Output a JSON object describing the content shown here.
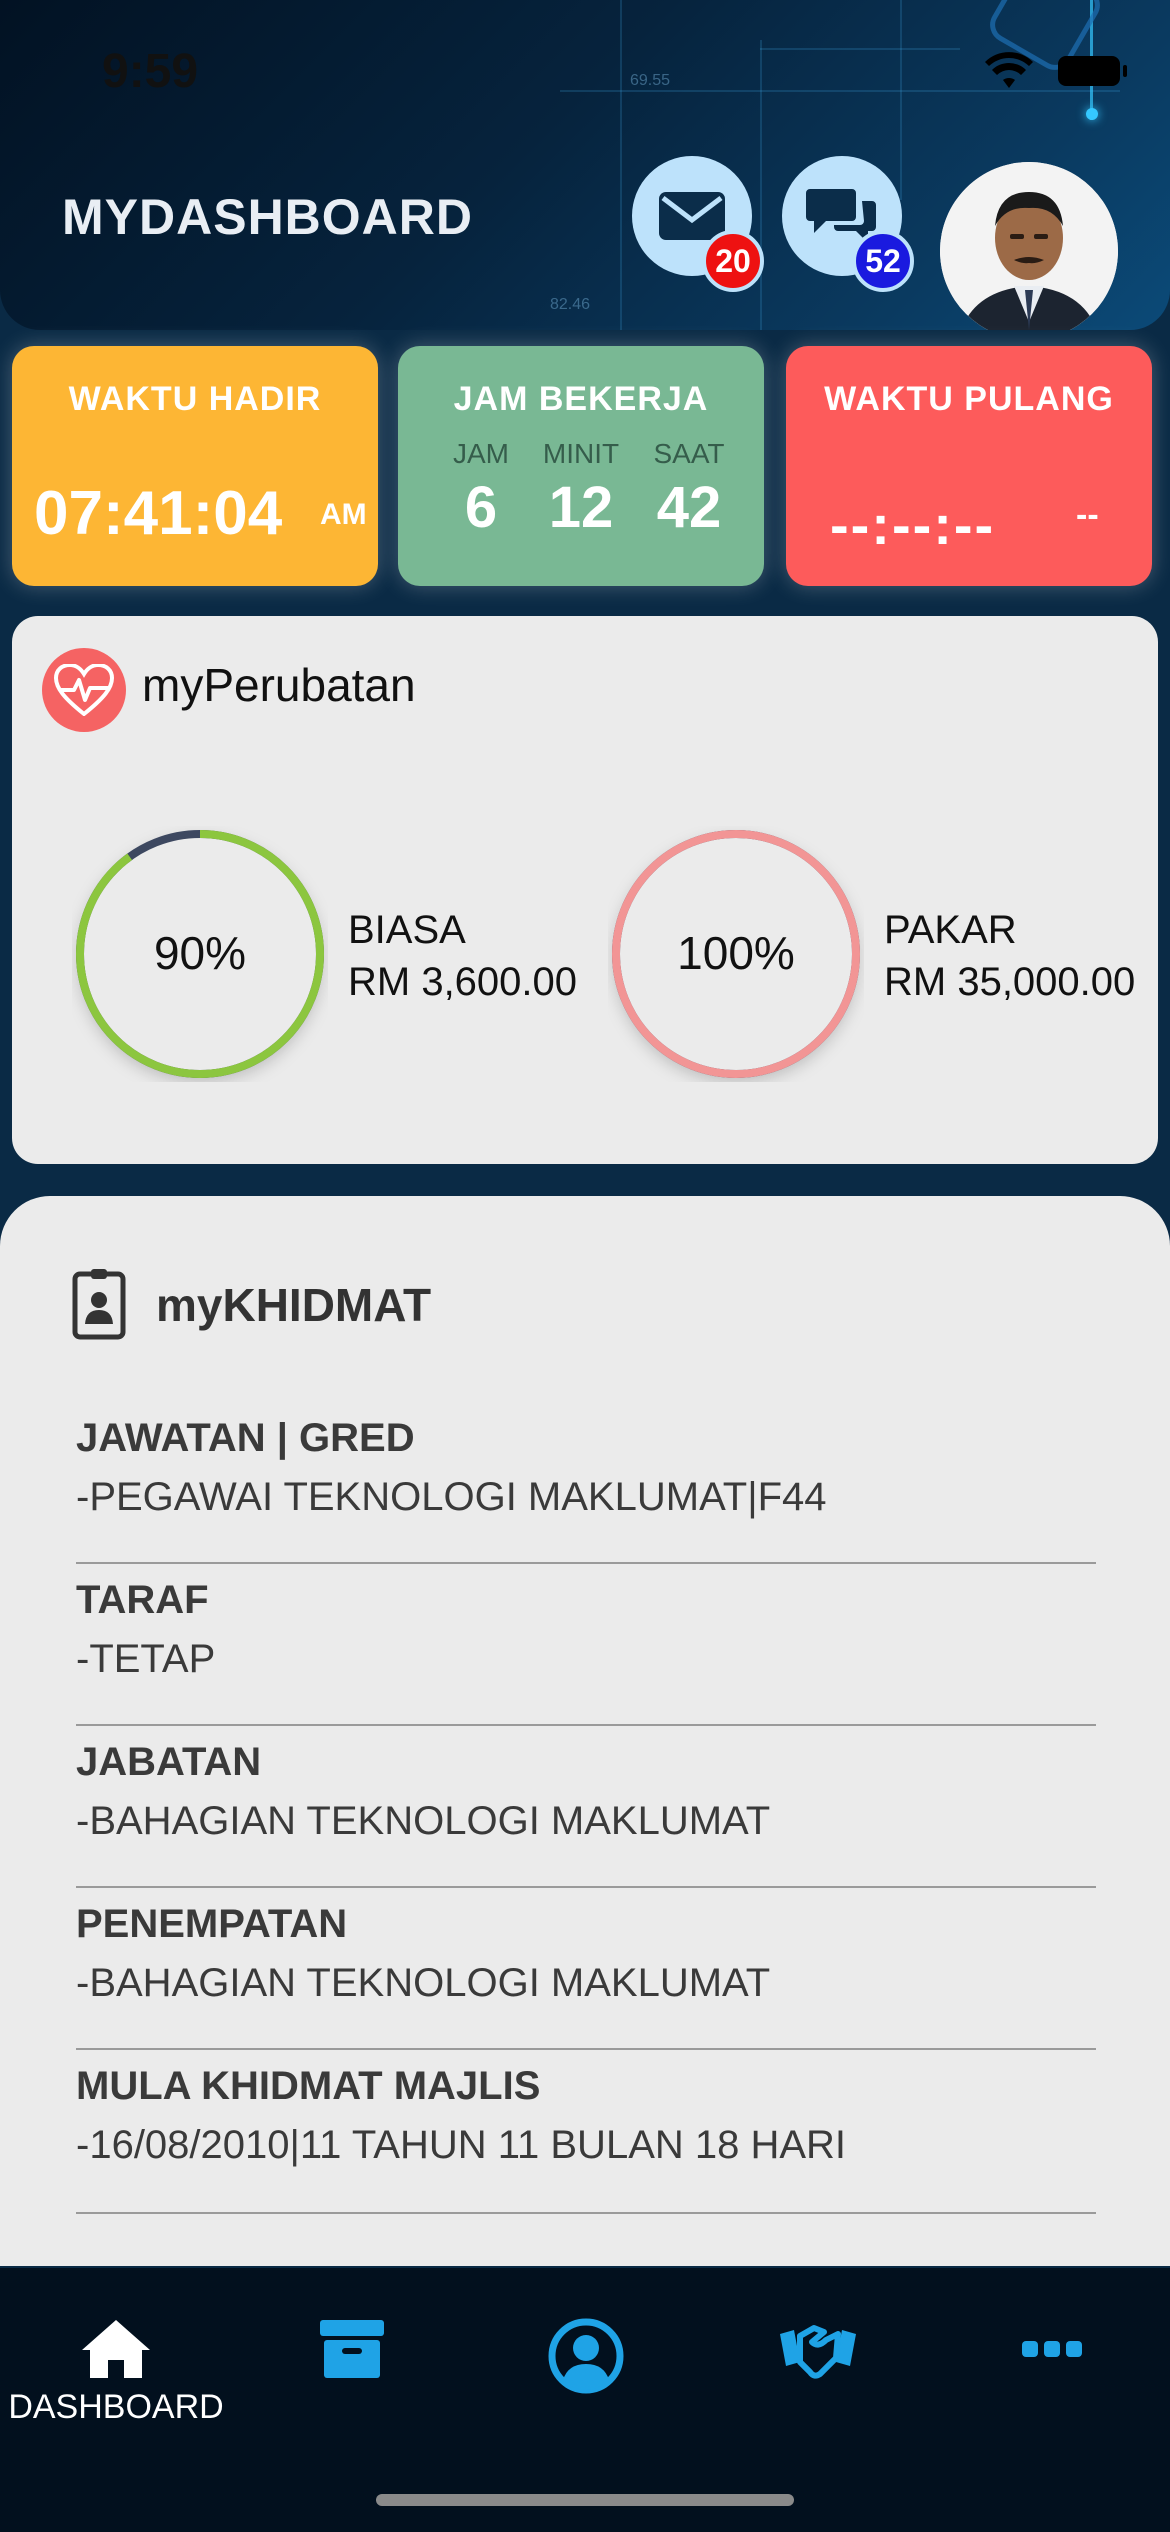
{
  "status_bar": {
    "time": "9:59"
  },
  "header": {
    "title": "MYDASHBOARD",
    "mail_count": "20",
    "chat_count": "52",
    "bg_numbers": [
      "69.55",
      "82.46"
    ]
  },
  "attendance": {
    "hadir": {
      "title": "WAKTU HADIR",
      "time": "07:41:04",
      "ampm": "AM"
    },
    "bekerja": {
      "title": "JAM BEKERJA",
      "columns": [
        {
          "label": "JAM",
          "value": "6"
        },
        {
          "label": "MINIT",
          "value": "12"
        },
        {
          "label": "SAAT",
          "value": "42"
        }
      ]
    },
    "pulang": {
      "title": "WAKTU PULANG",
      "time": "--:--:--",
      "ampm": "--"
    }
  },
  "perubatan": {
    "title": "myPerubatan",
    "items": [
      {
        "percent": "90%",
        "percent_value": 90,
        "type": "BIASA",
        "amount": "RM 3,600.00",
        "color": "#8cc63f"
      },
      {
        "percent": "100%",
        "percent_value": 100,
        "type": "PAKAR",
        "amount": "RM 35,000.00",
        "color": "#f29595"
      }
    ]
  },
  "khidmat": {
    "title": "myKHIDMAT",
    "rows": [
      {
        "label": "JAWATAN | GRED",
        "value": "-PEGAWAI TEKNOLOGI MAKLUMAT|F44"
      },
      {
        "label": "TARAF",
        "value": "-TETAP"
      },
      {
        "label": "JABATAN",
        "value": "-BAHAGIAN TEKNOLOGI MAKLUMAT"
      },
      {
        "label": "PENEMPATAN",
        "value": "-BAHAGIAN TEKNOLOGI MAKLUMAT"
      },
      {
        "label": "MULA KHIDMAT MAJLIS",
        "value": "-16/08/2010|11 TAHUN 11 BULAN 18 HARI"
      }
    ]
  },
  "nav": {
    "items": [
      {
        "label": "DASHBOARD",
        "icon": "home-icon"
      },
      {
        "label": "",
        "icon": "archive-icon"
      },
      {
        "label": "",
        "icon": "profile-icon"
      },
      {
        "label": "",
        "icon": "handshake-icon"
      },
      {
        "label": "",
        "icon": "more-icon"
      }
    ]
  },
  "colors": {
    "hadir": "#fdb634",
    "bekerja": "#79b894",
    "pulang": "#fd5b5b",
    "nav_accent": "#1fa3e6",
    "mail_badge": "#ee1111",
    "chat_badge": "#1a1adf"
  }
}
